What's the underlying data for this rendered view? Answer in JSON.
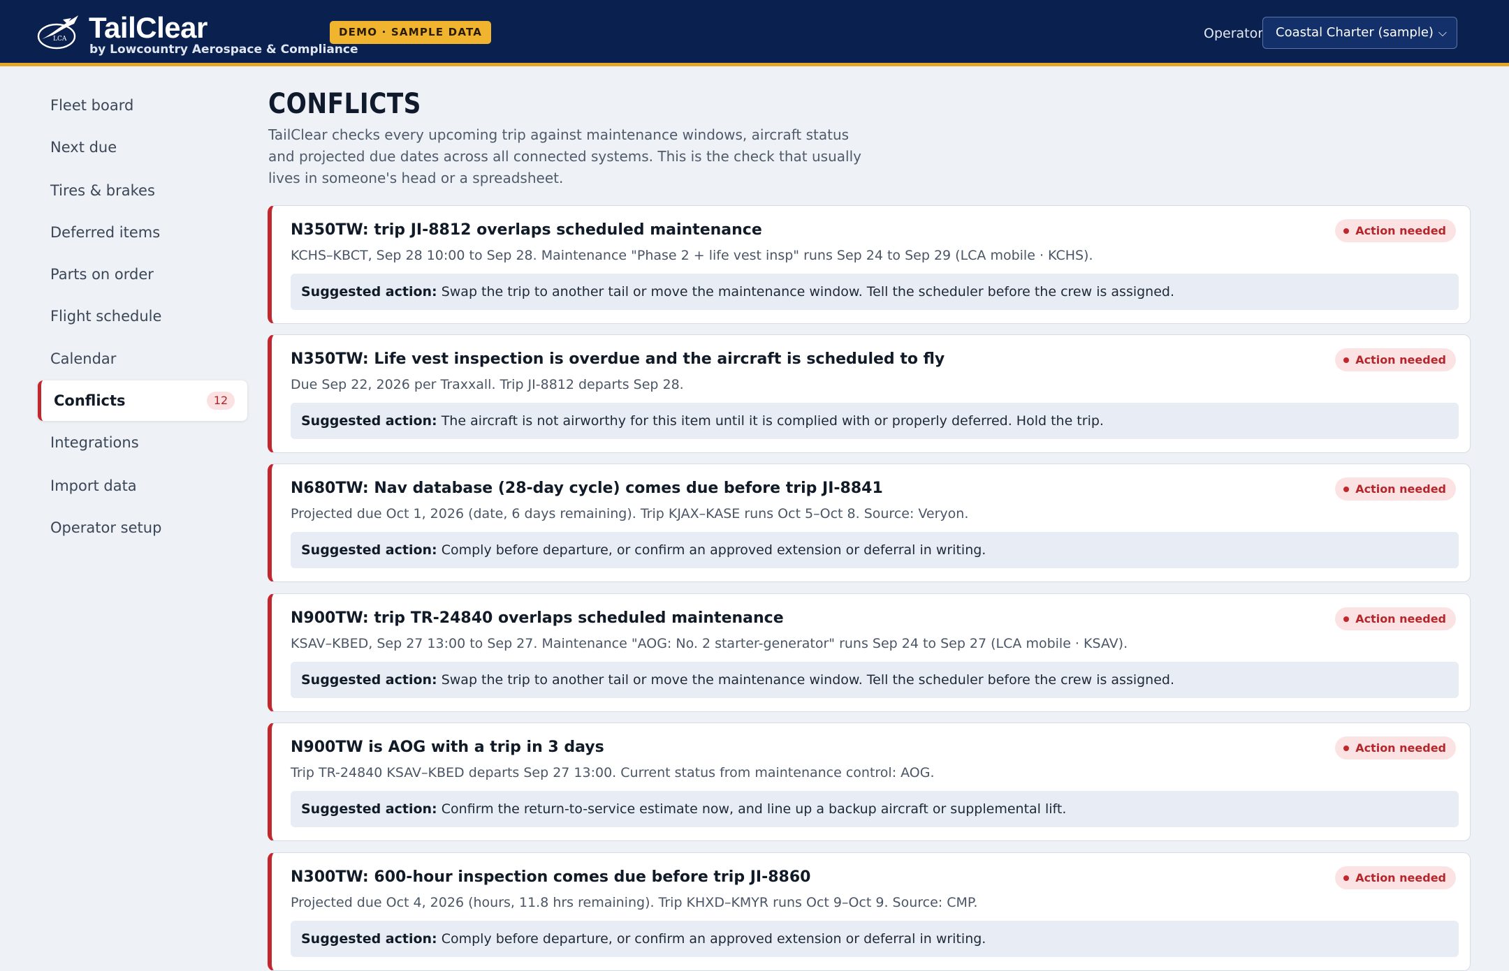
{
  "header": {
    "app_name": "TailClear",
    "subtitle": "by Lowcountry Aerospace & Compliance",
    "logo_text": "LCA",
    "demo_badge": "DEMO · SAMPLE DATA",
    "operator_label": "Operator",
    "operator_value": "Coastal Charter (sample)",
    "colors": {
      "bar": "#0a2150",
      "accent": "#e5a526"
    }
  },
  "sidebar": {
    "items": [
      {
        "label": "Fleet board"
      },
      {
        "label": "Next due"
      },
      {
        "label": "Tires & brakes"
      },
      {
        "label": "Deferred items"
      },
      {
        "label": "Parts on order"
      },
      {
        "label": "Flight schedule"
      },
      {
        "label": "Calendar"
      },
      {
        "label": "Conflicts",
        "count": "12",
        "active": true
      },
      {
        "label": "Integrations"
      },
      {
        "label": "Import data"
      },
      {
        "label": "Operator setup"
      }
    ]
  },
  "main": {
    "title": "CONFLICTS",
    "intro": "TailClear checks every upcoming trip against maintenance windows, aircraft status and projected due dates across all connected systems. This is the check that usually lives in someone's head or a spreadsheet.",
    "action_prefix": "Suggested action:",
    "conflicts": [
      {
        "title": "N350TW: trip JI-8812 overlaps scheduled maintenance",
        "detail": "KCHS–KBCT, Sep 28 10:00 to Sep 28. Maintenance \"Phase 2 + life vest insp\" runs Sep 24 to Sep 29 (LCA mobile · KCHS).",
        "action": "Swap the trip to another tail or move the maintenance window. Tell the scheduler before the crew is assigned.",
        "status": "Action needed"
      },
      {
        "title": "N350TW: Life vest inspection is overdue and the aircraft is scheduled to fly",
        "detail": "Due Sep 22, 2026 per Traxxall. Trip JI-8812 departs Sep 28.",
        "action": "The aircraft is not airworthy for this item until it is complied with or properly deferred. Hold the trip.",
        "status": "Action needed"
      },
      {
        "title": "N680TW: Nav database (28-day cycle) comes due before trip JI-8841",
        "detail": "Projected due Oct 1, 2026 (date, 6 days remaining). Trip KJAX–KASE runs Oct 5–Oct 8. Source: Veryon.",
        "action": "Comply before departure, or confirm an approved extension or deferral in writing.",
        "status": "Action needed"
      },
      {
        "title": "N900TW: trip TR-24840 overlaps scheduled maintenance",
        "detail": "KSAV–KBED, Sep 27 13:00 to Sep 27. Maintenance \"AOG: No. 2 starter-generator\" runs Sep 24 to Sep 27 (LCA mobile · KSAV).",
        "action": "Swap the trip to another tail or move the maintenance window. Tell the scheduler before the crew is assigned.",
        "status": "Action needed"
      },
      {
        "title": "N900TW is AOG with a trip in 3 days",
        "detail": "Trip TR-24840 KSAV–KBED departs Sep 27 13:00. Current status from maintenance control: AOG.",
        "action": "Confirm the return-to-service estimate now, and line up a backup aircraft or supplemental lift.",
        "status": "Action needed"
      },
      {
        "title": "N300TW: 600-hour inspection comes due before trip JI-8860",
        "detail": "Projected due Oct 4, 2026 (hours, 11.8 hrs remaining). Trip KHXD–KMYR runs Oct 9–Oct 9. Source: CMP.",
        "action": "Comply before departure, or confirm an approved extension or deferral in writing.",
        "status": "Action needed"
      }
    ],
    "colors": {
      "alert": "#c2272d",
      "alert_bg": "#fbe3e3"
    }
  }
}
